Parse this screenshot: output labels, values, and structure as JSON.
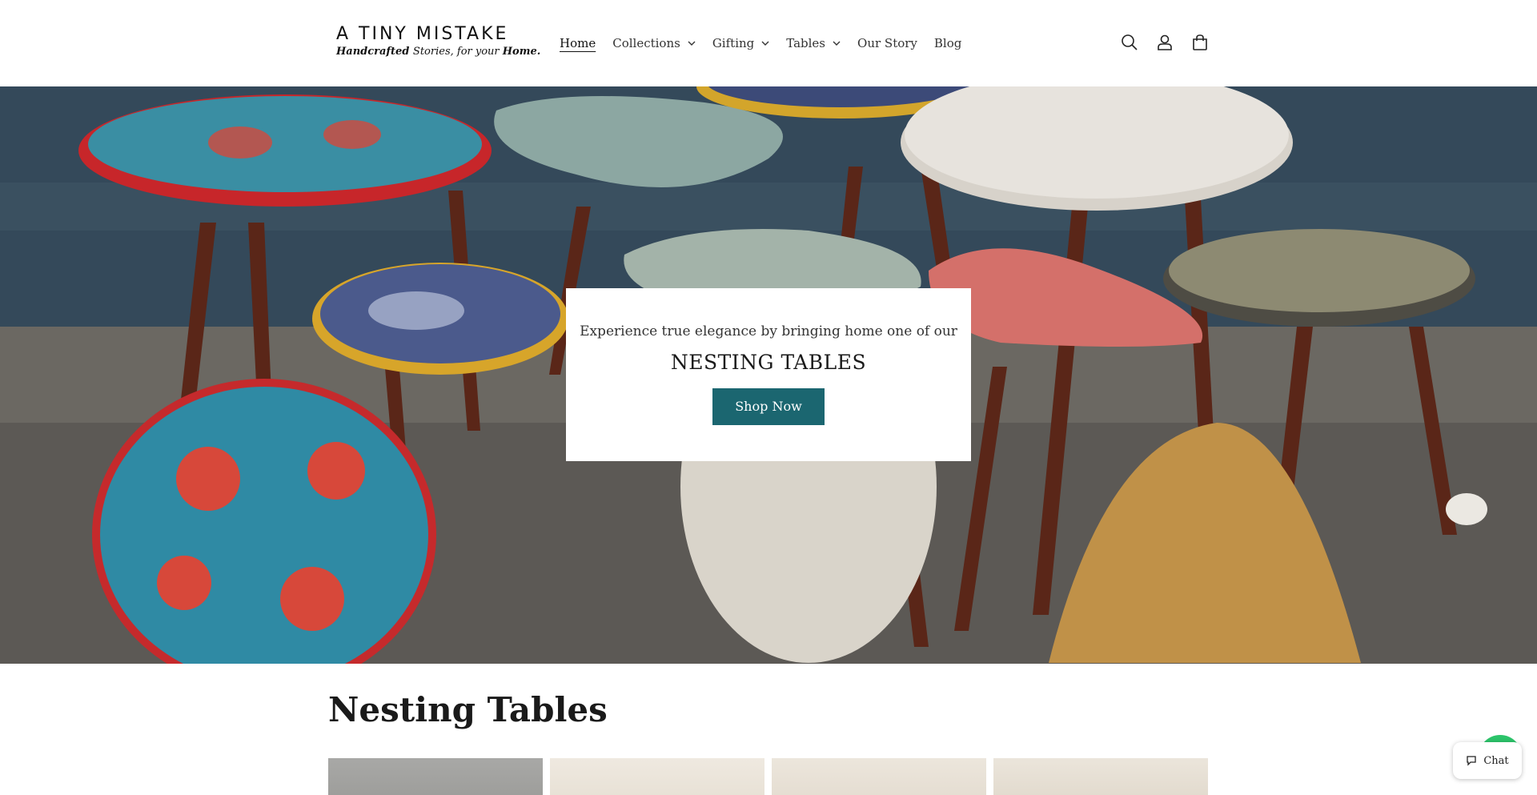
{
  "brand": {
    "name": "A TINY MISTAKE",
    "tagline_pre": "Handcrafted ",
    "tagline_mid": "Stories, for your ",
    "tagline_end": "Home."
  },
  "nav": {
    "items": [
      {
        "label": "Home",
        "active": true,
        "dropdown": false
      },
      {
        "label": "Collections",
        "active": false,
        "dropdown": true
      },
      {
        "label": "Gifting",
        "active": false,
        "dropdown": true
      },
      {
        "label": "Tables",
        "active": false,
        "dropdown": true
      },
      {
        "label": "Our Story",
        "active": false,
        "dropdown": false
      },
      {
        "label": "Blog",
        "active": false,
        "dropdown": false
      }
    ]
  },
  "header_icons": [
    "search-icon",
    "account-icon",
    "cart-icon"
  ],
  "hero": {
    "line": "Experience true elegance by bringing home one of our",
    "title": "NESTING TABLES",
    "button": "Shop Now"
  },
  "section": {
    "title": "Nesting Tables"
  },
  "chat": {
    "label": "Chat"
  },
  "colors": {
    "accent": "#1b6670",
    "chat_green": "#2cc46a"
  }
}
